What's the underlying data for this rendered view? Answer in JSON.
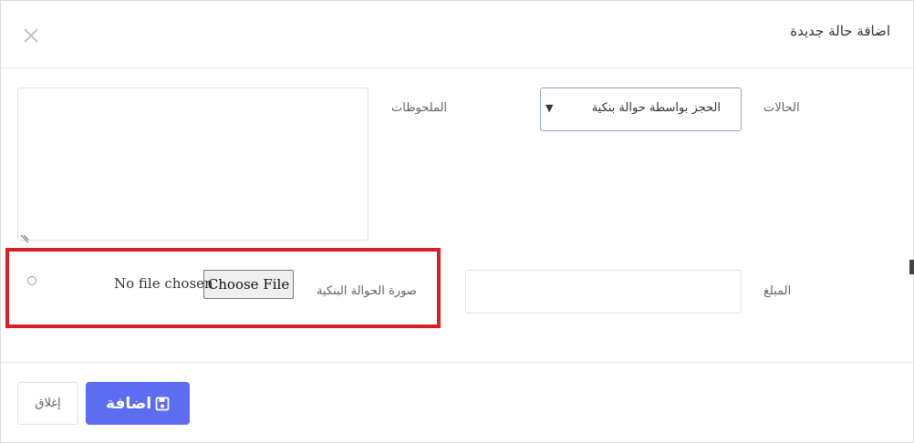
{
  "modal": {
    "title": "اضافة حالة جديدة"
  },
  "form": {
    "status": {
      "label": "الحالات",
      "selected": "الحجز بواسطة حوالة بنكية"
    },
    "notes": {
      "label": "الملحوظات",
      "value": ""
    },
    "amount": {
      "label": "المبلغ",
      "value": ""
    },
    "bank_transfer_image": {
      "label": "صورة الحوالة البنكية",
      "button_label": "Choose File",
      "status": "No file chosen"
    }
  },
  "footer": {
    "close_label": "إغلاق",
    "add_label": "اضافة"
  },
  "icons": {
    "close": "close-icon",
    "save": "floppy-disk-icon",
    "dropdown": "caret-down-icon"
  },
  "colors": {
    "primary": "#5d6df2",
    "highlight": "#d71f2b",
    "select_border": "#8ea2d8"
  }
}
